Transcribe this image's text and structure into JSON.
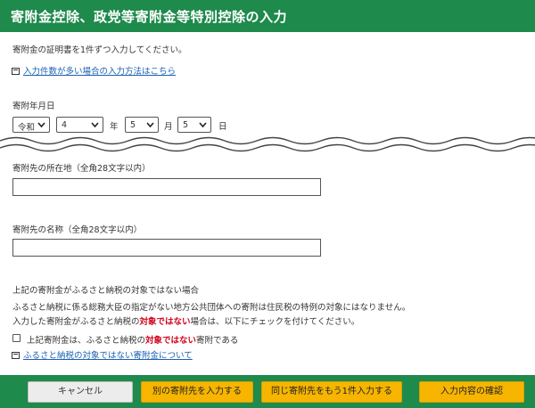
{
  "header": {
    "title": "寄附金控除、政党等寄附金等特別控除の入力"
  },
  "intro": {
    "instruction": "寄附金の証明書を1件ずつ入力してください。",
    "bulk_link": "入力件数が多い場合の入力方法はこちら"
  },
  "date": {
    "label": "寄附年月日",
    "era": "令和",
    "year": "4",
    "year_unit": "年",
    "month": "5",
    "month_unit": "月",
    "day": "5",
    "day_unit": "日"
  },
  "address": {
    "label": "寄附先の所在地（全角28文字以内）",
    "value": ""
  },
  "name": {
    "label": "寄附先の名称（全角28文字以内）",
    "value": ""
  },
  "furusato": {
    "heading": "上記の寄附金がふるさと納税の対象ではない場合",
    "note1": "ふるさと納税に係る総務大臣の指定がない地方公共団体への寄附は住民税の特例の対象にはなりません。",
    "note2_pre": "入力した寄附金がふるさと納税の",
    "note2_red": "対象ではない",
    "note2_post": "場合は、以下にチェックを付けてください。",
    "check_pre": "上記寄附金は、ふるさと納税の",
    "check_red": "対象ではない",
    "check_post": "寄附である",
    "checked": false,
    "link": "ふるさと納税の対象ではない寄附金について"
  },
  "footer": {
    "cancel": "キャンセル",
    "another": "別の寄附先を入力する",
    "same_again": "同じ寄附先をもう1件入力する",
    "confirm": "入力内容の確認"
  },
  "colors": {
    "header_green": "#1e8a4c",
    "button_yellow": "#f7b500",
    "link_blue": "#1a5fb4",
    "emphasis_red": "#d0021b"
  }
}
